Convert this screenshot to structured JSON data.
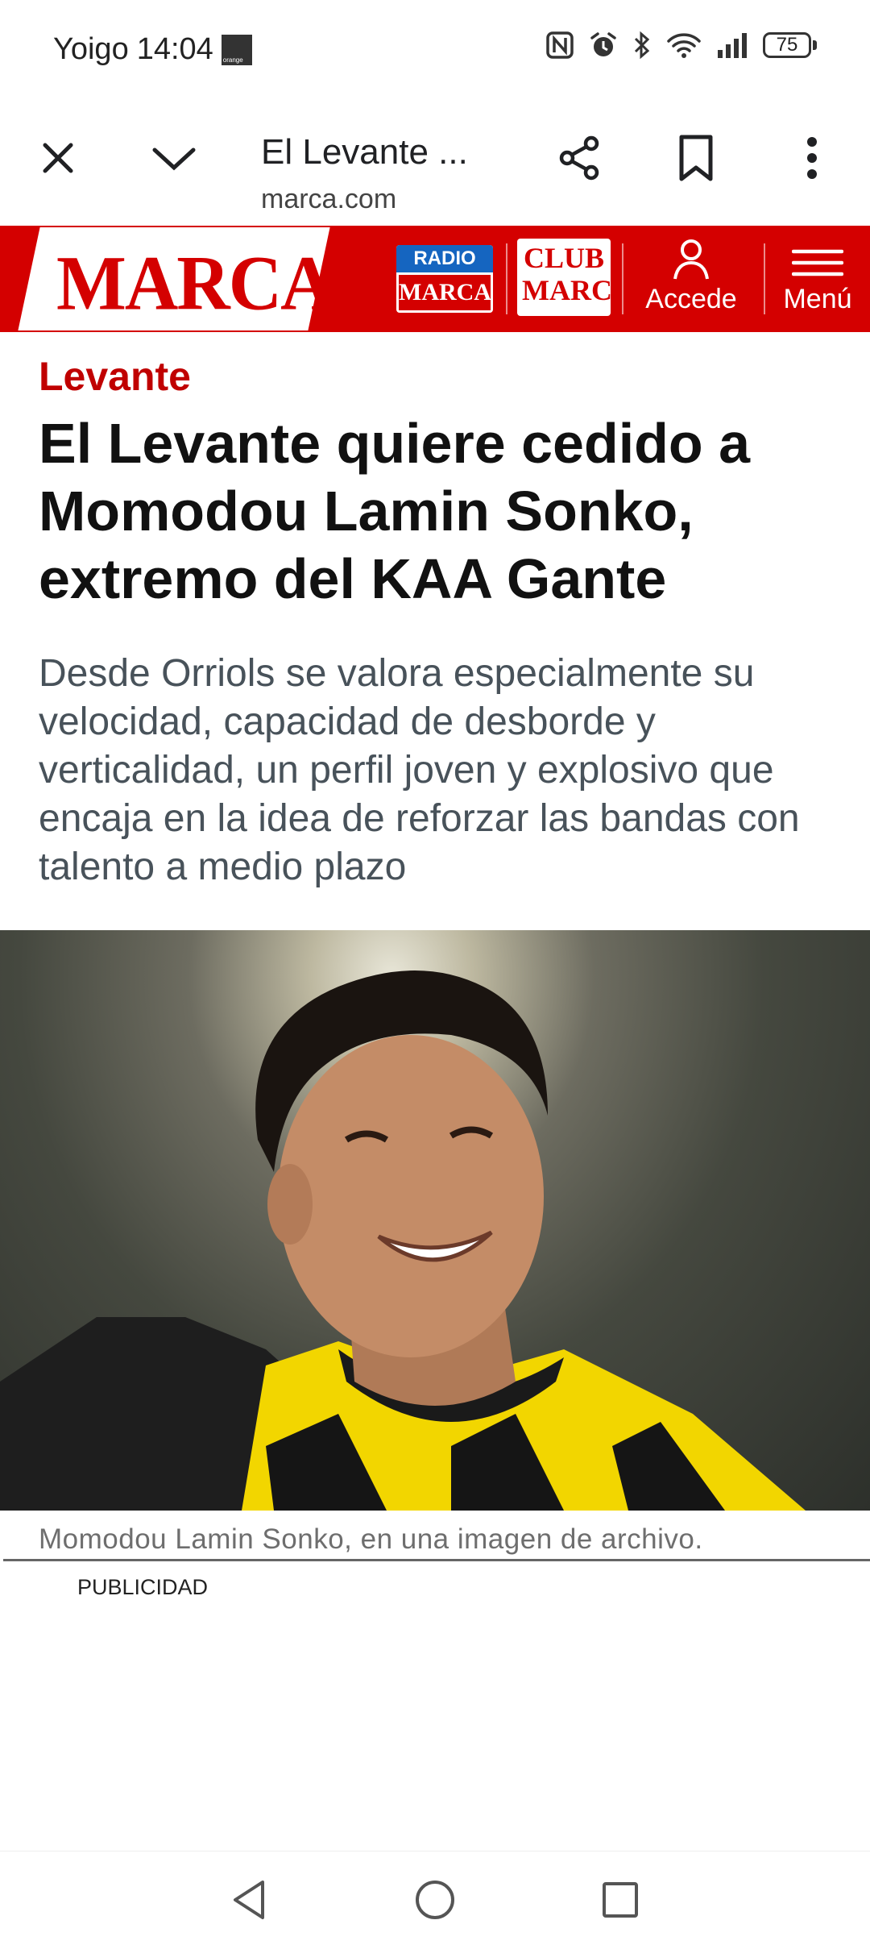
{
  "status_bar": {
    "carrier": "Yoigo",
    "time": "14:04",
    "carrier_badge": "orange",
    "battery": "75"
  },
  "browser": {
    "title": "El Levante ...",
    "url": "marca.com",
    "icons": [
      "close-icon",
      "chevron-down-icon",
      "share-icon",
      "bookmark-icon",
      "more-vert-icon"
    ]
  },
  "site_header": {
    "logo": "MARCA",
    "radio_top": "RADIO",
    "radio_bottom": "MARCA",
    "club_line1": "CLUB",
    "club_line2": "MARCA",
    "login_label": "Accede",
    "menu_label": "Menú",
    "brand_color": "#d40000"
  },
  "article": {
    "kicker": "Levante",
    "headline": "El Levante quiere cedido a Momodou Lamin Sonko, extremo del KAA Gante",
    "subhead": "Desde Orriols se valora especialmente su velocidad, capacidad de desborde y verticalidad, un perfil joven y explosivo que encaja en la idea de reforzar las bandas con talento a medio plazo",
    "photo_caption": "Momodou Lamin Sonko, en una imagen de archivo.",
    "ad_label": "PUBLICIDAD"
  },
  "nav_bar": {
    "icons": [
      "back-icon",
      "home-icon",
      "recents-icon"
    ]
  }
}
